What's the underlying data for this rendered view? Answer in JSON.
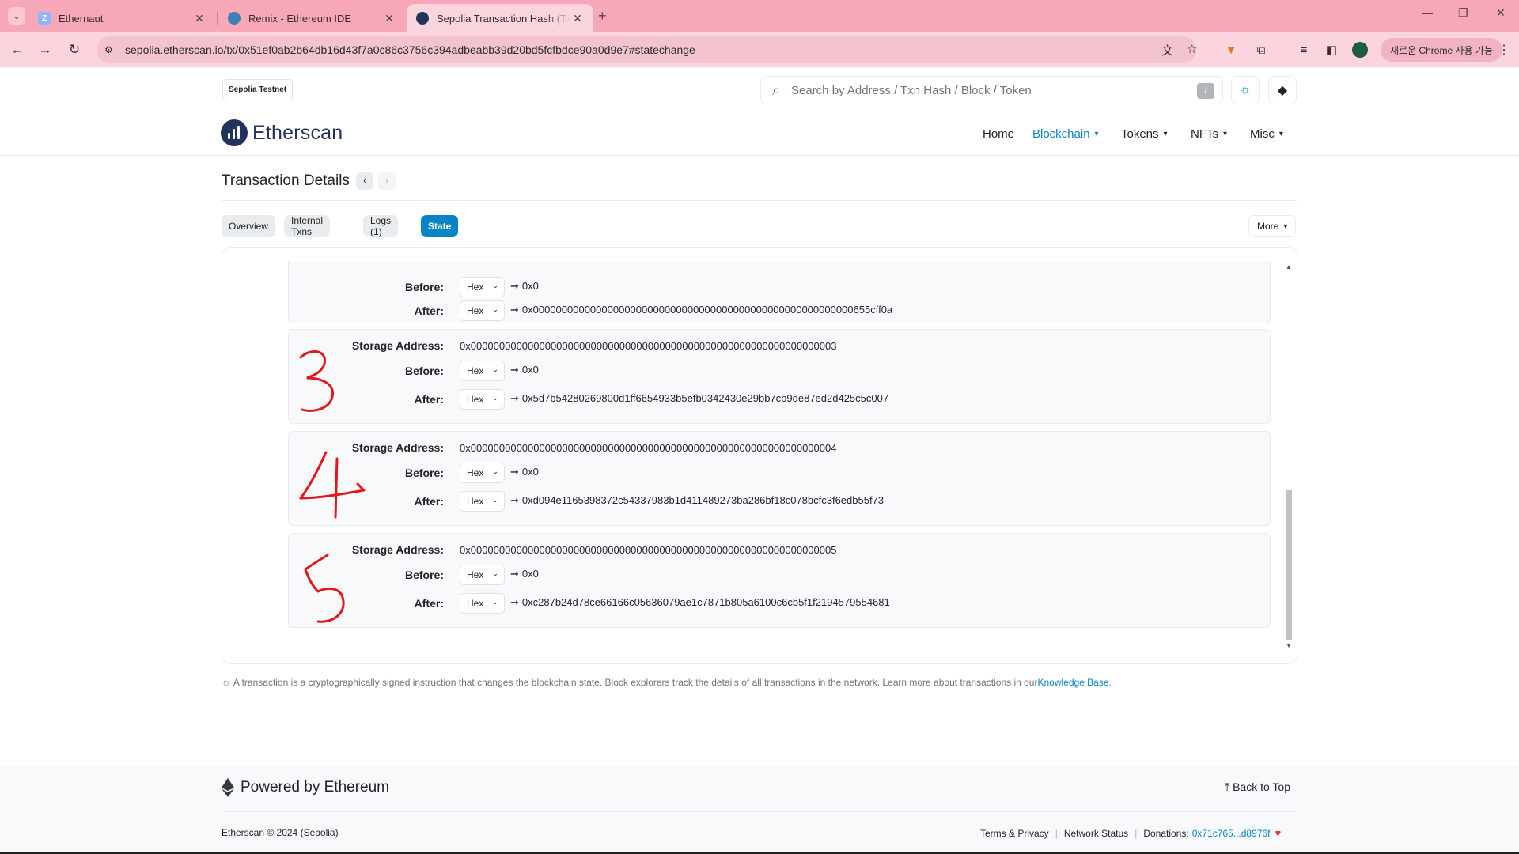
{
  "browser": {
    "tabs": [
      {
        "title": "Ethernaut",
        "favicon": "ethernaut-icon"
      },
      {
        "title": "Remix - Ethereum IDE",
        "favicon": "remix-icon"
      },
      {
        "title": "Sepolia Transaction Hash (Txha",
        "favicon": "etherscan-icon",
        "active": true
      }
    ],
    "url": "sepolia.etherscan.io/tx/0x51ef0ab2b64db16d43f7a0c86c3756c394adbeabb39d20bd5fcfbdce90a0d9e7#statechange",
    "chrome_pill": "새로운 Chrome 사용 가능",
    "colors": {
      "frame": "#f7a8b8",
      "toolbar": "#fbd5de"
    }
  },
  "site": {
    "network_badge": "Sepolia Testnet",
    "search_placeholder": "Search by Address / Txn Hash / Block / Token",
    "search_shortcut": "/",
    "logo_text": "Etherscan",
    "nav": [
      {
        "label": "Home"
      },
      {
        "label": "Blockchain",
        "active": true
      },
      {
        "label": "Tokens"
      },
      {
        "label": "NFTs"
      },
      {
        "label": "Misc"
      }
    ],
    "accent": "#0784c3"
  },
  "page": {
    "title": "Transaction Details",
    "tabs": [
      "Overview",
      "Internal Txns",
      "Logs (1)",
      "State"
    ],
    "active_tab": "State",
    "more_label": "More"
  },
  "state": {
    "labels": {
      "storage_address": "Storage Address:",
      "before": "Before:",
      "after": "After:",
      "format": "Hex",
      "arrow": "➞"
    },
    "partial_slot": {
      "before": "0x0",
      "after": "0x00000000000000000000000000000000000000000000000000000000655cff0a"
    },
    "slots": [
      {
        "storage_address": "0x0000000000000000000000000000000000000000000000000000000000000003",
        "before": "0x0",
        "after": "0x5d7b54280269800d1ff6654933b5efb0342430e29bb7cb9de87ed2d425c5c007"
      },
      {
        "storage_address": "0x0000000000000000000000000000000000000000000000000000000000000004",
        "before": "0x0",
        "after": "0xd094e1165398372c54337983b1d411489273ba286bf18c078bcfc3f6edb55f73"
      },
      {
        "storage_address": "0x0000000000000000000000000000000000000000000000000000000000000005",
        "before": "0x0",
        "after": "0xc287b24d78ce66166c05636079ae1c7871b805a6100c6cb5f1f2194579554681"
      }
    ]
  },
  "info": {
    "text": "A transaction is a cryptographically signed instruction that changes the blockchain state. Block explorers track the details of all transactions in the network. Learn more about transactions in our ",
    "link": "Knowledge Base",
    "tail": "."
  },
  "footer": {
    "powered": "Powered by Ethereum",
    "back_to_top": "Back to Top",
    "copyright": "Etherscan © 2024 (Sepolia)",
    "links": [
      "Terms & Privacy",
      "Network Status"
    ],
    "donations_label": "Donations:",
    "donations_addr": "0x71c765...d8976f"
  }
}
